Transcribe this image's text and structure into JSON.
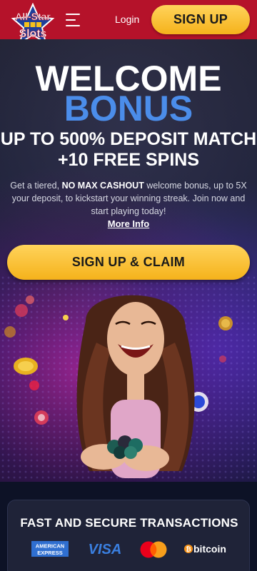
{
  "header": {
    "logo": {
      "line1": "All-Star",
      "line2": "Slots"
    },
    "login_label": "Login",
    "signup_label": "SIGN UP"
  },
  "hero": {
    "title_line1": "WELCOME",
    "title_line2": "BONUS",
    "subtitle_line1": "UP TO 500% DEPOSIT MATCH",
    "subtitle_line2": "+10 FREE SPINS",
    "desc_part1": "Get a tiered, ",
    "desc_bold": "NO MAX CASHOUT",
    "desc_part2": " welcome bonus, up to 5X your deposit, to kickstart your winning streak. Join now and start playing today!",
    "more_info_label": "More Info",
    "claim_label": "SIGN UP & CLAIM"
  },
  "transactions": {
    "title": "FAST AND SECURE TRANSACTIONS",
    "amex_line1": "AMERICAN",
    "amex_line2": "EXPRESS",
    "visa_label": "VISA",
    "bitcoin_label": "bitcoin"
  },
  "colors": {
    "header_bg": "#b5122a",
    "cta_yellow": "#f5b21b",
    "bonus_blue": "#4b8dea",
    "page_bg": "#0d1226"
  },
  "icons": [
    "all-star-slots-logo",
    "hamburger-menu-icon",
    "amex-icon",
    "visa-icon",
    "mastercard-icon",
    "bitcoin-icon"
  ]
}
